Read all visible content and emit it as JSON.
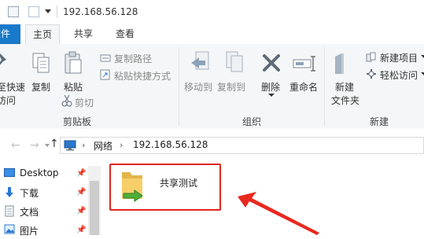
{
  "titlebar": {
    "path": "192.168.56.128"
  },
  "tabs": {
    "file": "文件",
    "home": "主页",
    "share": "共享",
    "view": "查看"
  },
  "ribbon": {
    "pin_label_1": "至快速",
    "pin_label_2": "访问",
    "copy": "复制",
    "paste": "粘贴",
    "copy_path": "复制路径",
    "paste_shortcut": "粘贴快捷方式",
    "cut": "剪切",
    "clipboard_group": "剪贴板",
    "move_to": "移动到",
    "copy_to": "复制到",
    "delete": "删除",
    "rename": "重命名",
    "organize_group": "组织",
    "new_folder_1": "新建",
    "new_folder_2": "文件夹",
    "new_item": "新建项目",
    "easy_access": "轻松访问",
    "new_group": "新建"
  },
  "address": {
    "network": "网络",
    "host": "192.168.56.128"
  },
  "nav": {
    "desktop": "Desktop",
    "downloads": "下载",
    "documents": "文档",
    "pictures": "图片"
  },
  "folder": {
    "name": "共享测试"
  },
  "colors": {
    "accent": "#1979ca",
    "highlight": "#e0261d",
    "arrow": "#e8291f"
  }
}
